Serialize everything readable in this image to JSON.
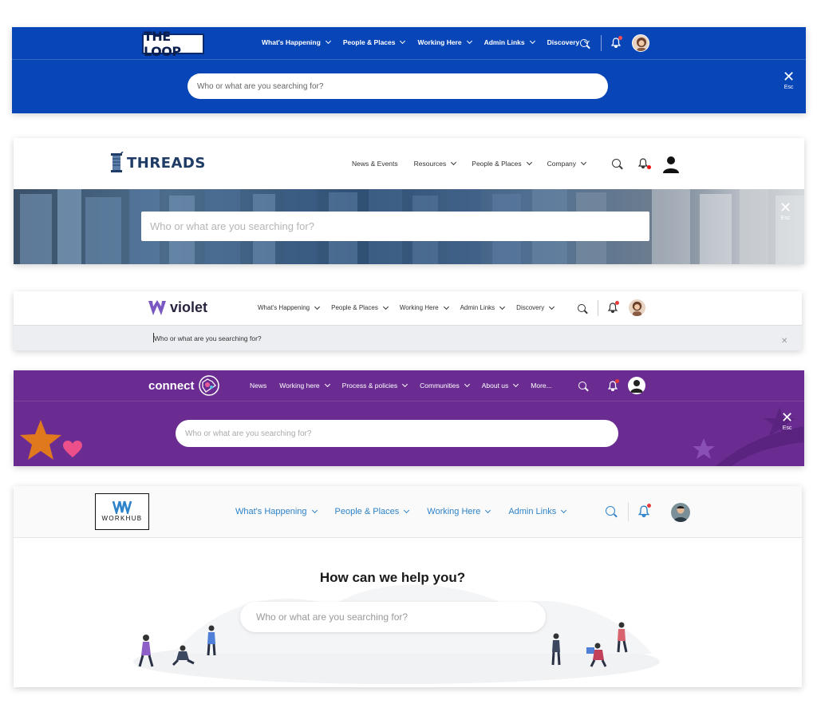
{
  "colors": {
    "loop_blue": "#0846b8",
    "connect_purple": "#6a2c91",
    "workhub_blue": "#2d82c9",
    "threads_navy": "#1f3c66",
    "violet_purple": "#7b57c2"
  },
  "panels": [
    {
      "brand": "THE LOOP",
      "nav": [
        "What's Happening",
        "People & Places",
        "Working Here",
        "Admin Links",
        "Discovery"
      ],
      "search_placeholder": "Who or what are you searching for?",
      "close_label": "Esc"
    },
    {
      "brand": "THREADS",
      "nav": [
        "News & Events",
        "Resources",
        "People & Places",
        "Company"
      ],
      "search_placeholder": "Who or what are you searching for?",
      "close_label": "Esc"
    },
    {
      "brand": "violet",
      "nav": [
        "What's Happening",
        "People & Places",
        "Working Here",
        "Admin Links",
        "Discovery"
      ],
      "search_placeholder": "Who or what are you searching for?"
    },
    {
      "brand": "connect",
      "nav": [
        "News",
        "Working here",
        "Process & policies",
        "Communities",
        "About us",
        "More..."
      ],
      "search_placeholder": "Who or what are you searching for?",
      "close_label": "Esc"
    },
    {
      "brand": "WORKHUB",
      "nav": [
        "What's Happening",
        "People & Places",
        "Working Here",
        "Admin Links"
      ],
      "heading": "How can we help you?",
      "search_placeholder": "Who or what are you searching for?"
    }
  ]
}
